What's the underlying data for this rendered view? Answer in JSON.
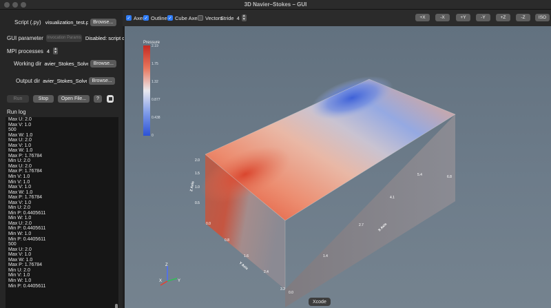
{
  "window": {
    "title": "3D Navier–Stokes – GUI"
  },
  "left": {
    "script_label": "Script (.py)",
    "script_value": "visualization_test.py",
    "browse_label": "Browse...",
    "gui_param_label": "GUI parameter",
    "gui_param_button": "Invocation Params",
    "gui_param_status": "Disabled: script de",
    "mpi_label": "MPI processes",
    "mpi_value": "4",
    "working_dir_label": "Working dir",
    "working_dir_value": "avier_Stokes_Solver",
    "output_dir_label": "Output dir",
    "output_dir_value": "avier_Stokes_Solver",
    "run_label": "Run",
    "stop_label": "Stop",
    "open_file_label": "Open File...",
    "help_label": "?",
    "run_log_label": "Run log",
    "log_lines": [
      "Max U: 2.0",
      "Max V: 1.0",
      "500",
      "Max W: 1.0",
      "Max U: 2.0",
      "Max V: 1.0",
      "Max W: 1.0",
      "Max P: 1.76784",
      "Min U: 2.0",
      "Max U: 2.0",
      "Max P: 1.76784",
      "Min V: 1.0",
      "Min V: 1.0",
      "Max V: 1.0",
      "Max W: 1.0",
      "Max P: 1.76784",
      "Max V: 1.0",
      "Min U: 2.0",
      "Min P: 0.4405611",
      "Min W: 1.0",
      "Max U: 2.0",
      "Min P: 0.4405611",
      "Min W: 1.0",
      "Min P: 0.4405611",
      "500",
      "Max U: 2.0",
      "Max V: 1.0",
      "Max W: 1.0",
      "Max P: 1.76784",
      "Min U: 2.0",
      "Min V: 1.0",
      "Min W: 1.0",
      "Min P: 0.4405611"
    ]
  },
  "toolbar": {
    "axes_label": "Axes",
    "outline_label": "Outline",
    "cube_axes_label": "Cube Axes",
    "vectors_label": "Vectors",
    "stride_label": "Stride",
    "stride_value": "4",
    "view_buttons": [
      "+X",
      "-X",
      "+Y",
      "-Y",
      "+Z",
      "-Z",
      "ISO"
    ]
  },
  "viewport": {
    "colorbar_title": "Pressure",
    "colorbar_ticks": [
      "2.19",
      "1.75",
      "1.32",
      "0.877",
      "0.438",
      "0"
    ],
    "x_axis_title": "X Axis",
    "y_axis_title": "Y Axis",
    "z_axis_title": "Z Axis",
    "x_ticks": [
      "0.0",
      "1.4",
      "2.7",
      "4.1",
      "5.4",
      "6.8"
    ],
    "y_ticks": [
      "0.0",
      "0.8",
      "1.6",
      "2.4",
      "3.2"
    ],
    "z_ticks": [
      "2.0",
      "1.5",
      "1.0",
      "0.5"
    ],
    "triad": {
      "x": "X",
      "y": "Y",
      "z": "Z"
    }
  },
  "dock": {
    "app_label": "Xcode"
  },
  "colors": {
    "accent": "#2f7cf6",
    "pressure_high": "#e04a36",
    "pressure_low": "#3a63d9"
  }
}
